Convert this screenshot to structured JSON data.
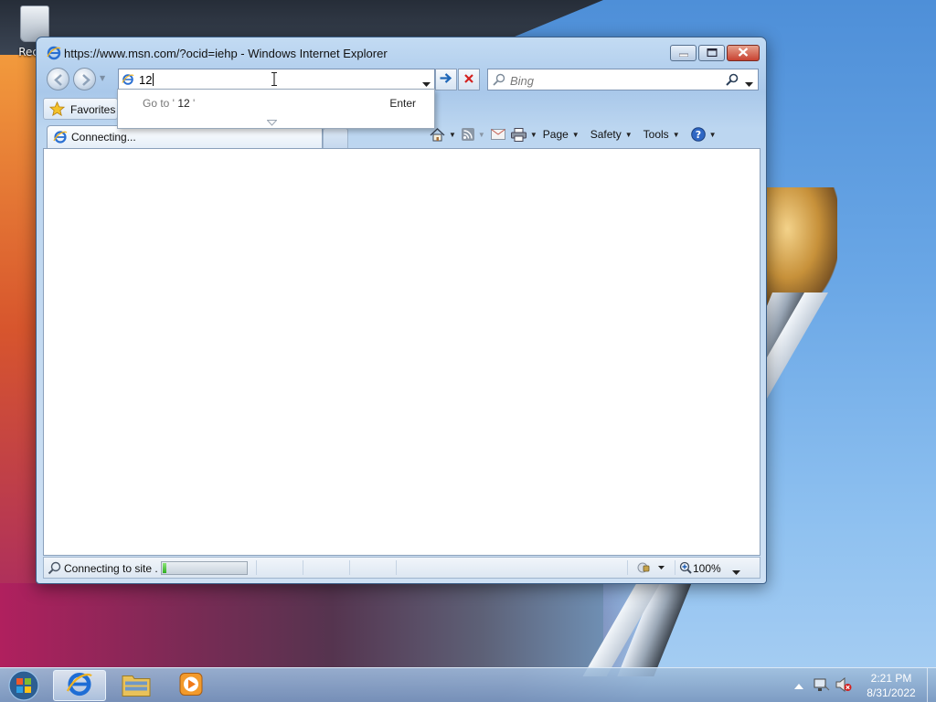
{
  "desktop": {
    "icons": [
      {
        "label": "Recyc",
        "icon": "recycle-bin-icon"
      }
    ]
  },
  "window": {
    "title": "https://www.msn.com/?ocid=iehp - Windows Internet Explorer",
    "address_value": "12",
    "search_placeholder": "Bing",
    "favorites_label": "Favorites",
    "tab_label": "Connecting...",
    "autocomplete": {
      "goto_prefix": "Go to '",
      "goto_term": " 12 ",
      "goto_suffix": "'",
      "enter_label": "Enter"
    },
    "command_bar": {
      "page_label": "Page",
      "safety_label": "Safety",
      "tools_label": "Tools"
    },
    "status": {
      "text": "Connecting to site .",
      "progress": 0.04,
      "zoom": "100%"
    }
  },
  "taskbar": {
    "time": "2:21 PM",
    "date": "8/31/2022",
    "apps": [
      "internet-explorer",
      "windows-explorer",
      "media-player"
    ]
  },
  "colors": {
    "accent": "#3a5e88",
    "progress_green": "#2fae1f",
    "close_red": "#c84231"
  }
}
